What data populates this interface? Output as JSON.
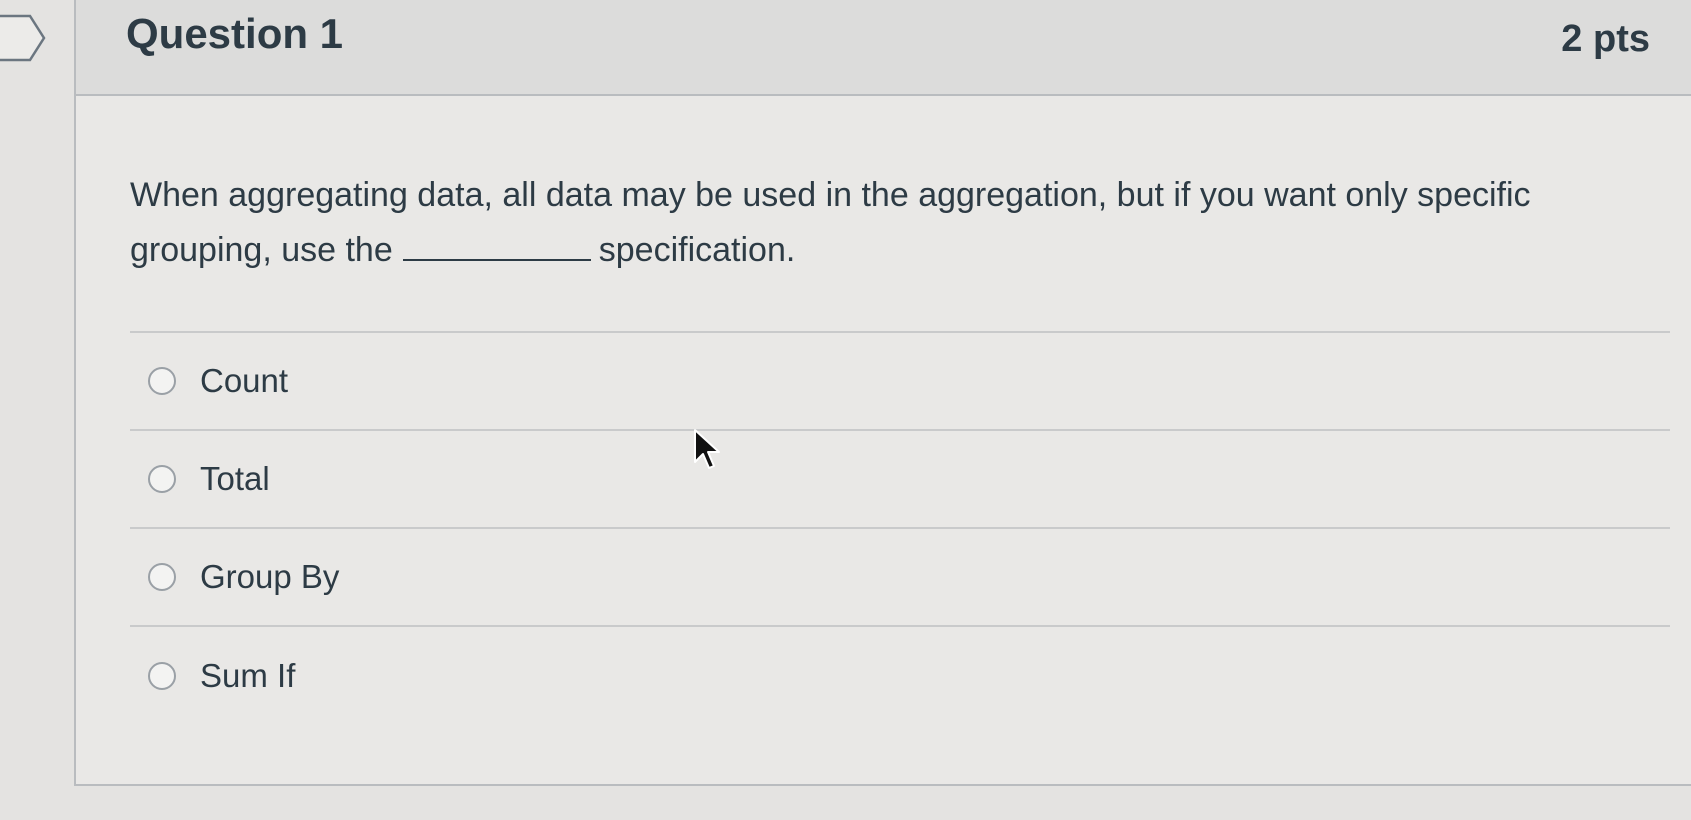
{
  "question": {
    "title": "Question 1",
    "points": "2 pts",
    "text_before_blank": "When aggregating data, all data may be used in the aggregation, but if you want only specific grouping, use the",
    "text_after_blank": "specification."
  },
  "answers": [
    {
      "label": "Count",
      "selected": false
    },
    {
      "label": "Total",
      "selected": false
    },
    {
      "label": "Group By",
      "selected": false
    },
    {
      "label": "Sum If",
      "selected": false
    }
  ],
  "icons": {
    "flag": "bookmark-flag-icon",
    "radio": "radio-circle",
    "cursor": "mouse-pointer-icon"
  },
  "colors": {
    "text": "#2d3b45",
    "background": "#e4e3e1",
    "header": "#dcdcdb",
    "border": "#b9bcbf"
  }
}
